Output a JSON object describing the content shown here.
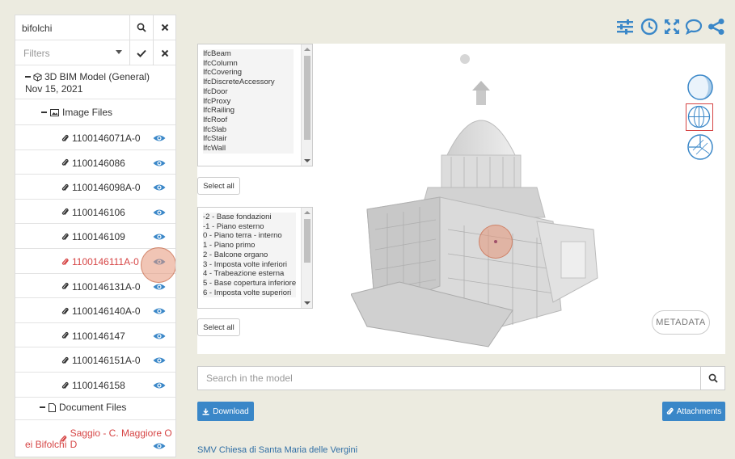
{
  "search": {
    "value": "bifolchi"
  },
  "filters": {
    "placeholder": "Filters"
  },
  "tree": {
    "model_title": "3D BIM Model (General)",
    "model_date": "Nov 15, 2021",
    "image_group": "Image Files",
    "files": [
      "1100146071A-0",
      "1100146086",
      "1100146098A-0",
      "1100146106",
      "1100146109",
      "1100146111A-0",
      "1100146131A-0",
      "1100146140A-0",
      "1100146147",
      "1100146151A-0",
      "1100146158"
    ],
    "active_file_index": 5,
    "document_group": "Document Files",
    "document_line1": "Saggio - C. Maggiore O D",
    "document_line2": "ei Bifolchi"
  },
  "ifc_classes": [
    "IfcBeam",
    "IfcColumn",
    "IfcCovering",
    "IfcDiscreteAccessory",
    "IfcDoor",
    "IfcProxy",
    "IfcRailing",
    "IfcRoof",
    "IfcSlab",
    "IfcStair",
    "IfcWall"
  ],
  "levels": [
    "-2 - Base fondazioni",
    "-1 - Piano esterno",
    "0 - Piano terra - interno",
    "1 - Piano primo",
    "2 - Balcone organo",
    "3 - Imposta volte inferiori",
    "4 - Trabeazione esterna",
    "5 - Base copertura inferiore",
    "6 - Imposta volte superiori"
  ],
  "buttons": {
    "select_all_1": "Select all",
    "select_all_2": "Select all",
    "metadata": "METADATA",
    "download": "Download",
    "attachments": "Attachments"
  },
  "model_search": {
    "placeholder": "Search in the model"
  },
  "footer": {
    "link": "SMV Chiesa di Santa Maria delle Vergini"
  },
  "colors": {
    "accent": "#3a87c8",
    "active": "#d64545",
    "eye": "#3a87c8",
    "toolbar": "#3a87c8",
    "highlight": "#e6967866"
  }
}
